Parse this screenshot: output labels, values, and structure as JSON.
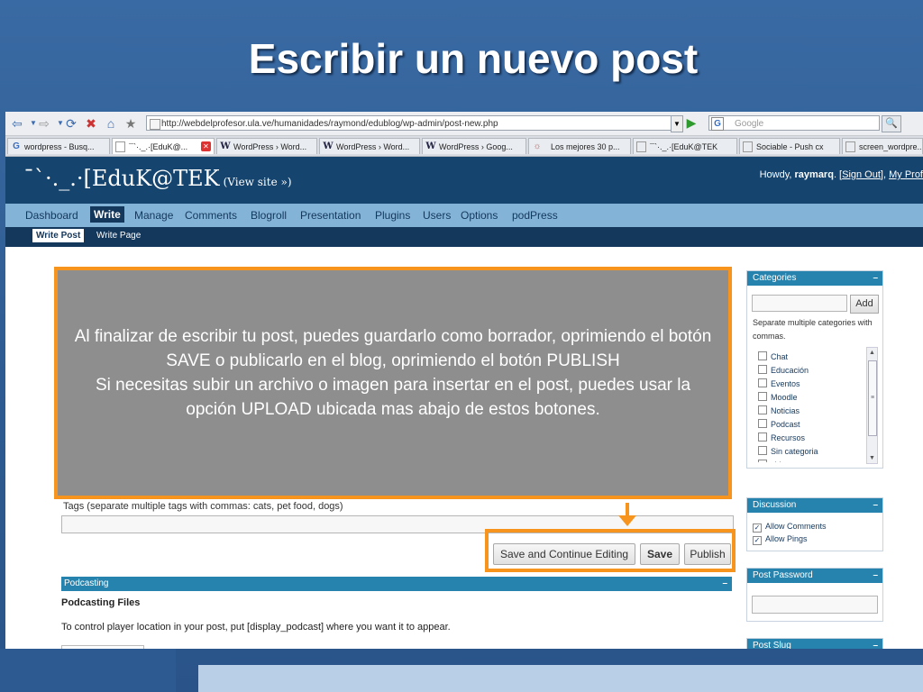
{
  "slide": {
    "title": "Escribir un nuevo post"
  },
  "browser": {
    "url": "http://webdelprofesor.ula.ve/humanidades/raymond/edublog/wp-admin/post-new.php",
    "search_placeholder": "Google",
    "tabs": [
      {
        "icon": "G",
        "label": "wordpress - Busq..."
      },
      {
        "icon": "doc",
        "label": "¯`·._.·[EduK@..."
      },
      {
        "icon": "W",
        "label": "WordPress › Word..."
      },
      {
        "icon": "W",
        "label": "WordPress › Word..."
      },
      {
        "icon": "W",
        "label": "WordPress › Goog..."
      },
      {
        "icon": "globe",
        "label": "Los mejores 30 p..."
      },
      {
        "icon": "doc",
        "label": "¯`·._.·[EduK@TEK"
      },
      {
        "icon": "doc",
        "label": "Sociable - Push cx"
      },
      {
        "icon": "doc",
        "label": "screen_wordpre..."
      }
    ]
  },
  "wp": {
    "site_title": "¯`·._.·[EduK@TEK",
    "view_site": "(View site »)",
    "howdy": "Howdy,",
    "user": "raymarq",
    "sign_out": "Sign Out",
    "my_profile": "My Prof",
    "menu": [
      "Dashboard",
      "Write",
      "Manage",
      "Comments",
      "Blogroll",
      "Presentation",
      "Plugins",
      "Users",
      "Options",
      "podPress"
    ],
    "submenu": [
      "Write Post",
      "Write Page"
    ],
    "tags_label": "Tags (separate multiple tags with commas: cats, pet food, dogs)",
    "buttons": {
      "save_continue": "Save and Continue Editing",
      "save": "Save",
      "publish": "Publish"
    },
    "podcasting": {
      "header": "Podcasting",
      "files_title": "Podcasting Files",
      "description": "To control player location in your post, put [display_podcast] where you want it to appear."
    },
    "categories": {
      "header": "Categories",
      "add_button": "Add",
      "note": "Separate multiple categories with commas.",
      "items": [
        "Chat",
        "Educación",
        "Eventos",
        "Moodle",
        "Noticias",
        "Podcast",
        "Recursos",
        "Sin categoria",
        "videos"
      ]
    },
    "discussion": {
      "header": "Discussion",
      "allow_comments": "Allow Comments",
      "allow_pings": "Allow Pings"
    },
    "post_password": {
      "header": "Post Password"
    },
    "post_slug": {
      "header": "Post Slug"
    }
  },
  "callout": {
    "line1": "Al finalizar de escribir tu post,  puedes guardarlo como borrador, oprimiendo el botón SAVE o publicarlo en el blog, oprimiendo el botón PUBLISH",
    "line2": "Si necesitas subir un archivo o imagen para insertar en el post, puedes usar la opción UPLOAD ubicada mas abajo de estos botones."
  }
}
